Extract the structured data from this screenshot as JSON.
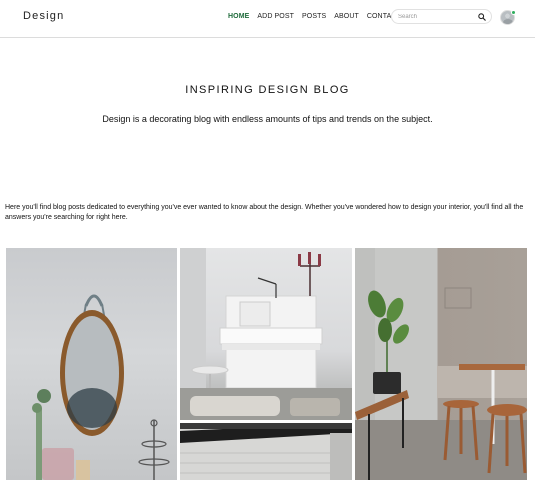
{
  "brand": "Design",
  "nav": {
    "items": [
      "HOME",
      "ADD POST",
      "POSTS",
      "ABOUT",
      "CONTACT"
    ],
    "active": "HOME"
  },
  "search": {
    "placeholder": "Search",
    "icon": "search-icon"
  },
  "hero": {
    "title": "INSPIRING DESIGN BLOG",
    "subtitle": "Design is a decorating blog with endless amounts of tips and trends on the subject."
  },
  "intro": "Here you'll find blog posts dedicated to everything you've ever wanted to know about the design. Whether you've wondered how to design your interior, you'll find all the answers you're searching for right here.",
  "colors": {
    "accent": "#1f6b3b",
    "status_online": "#2fae5e"
  }
}
